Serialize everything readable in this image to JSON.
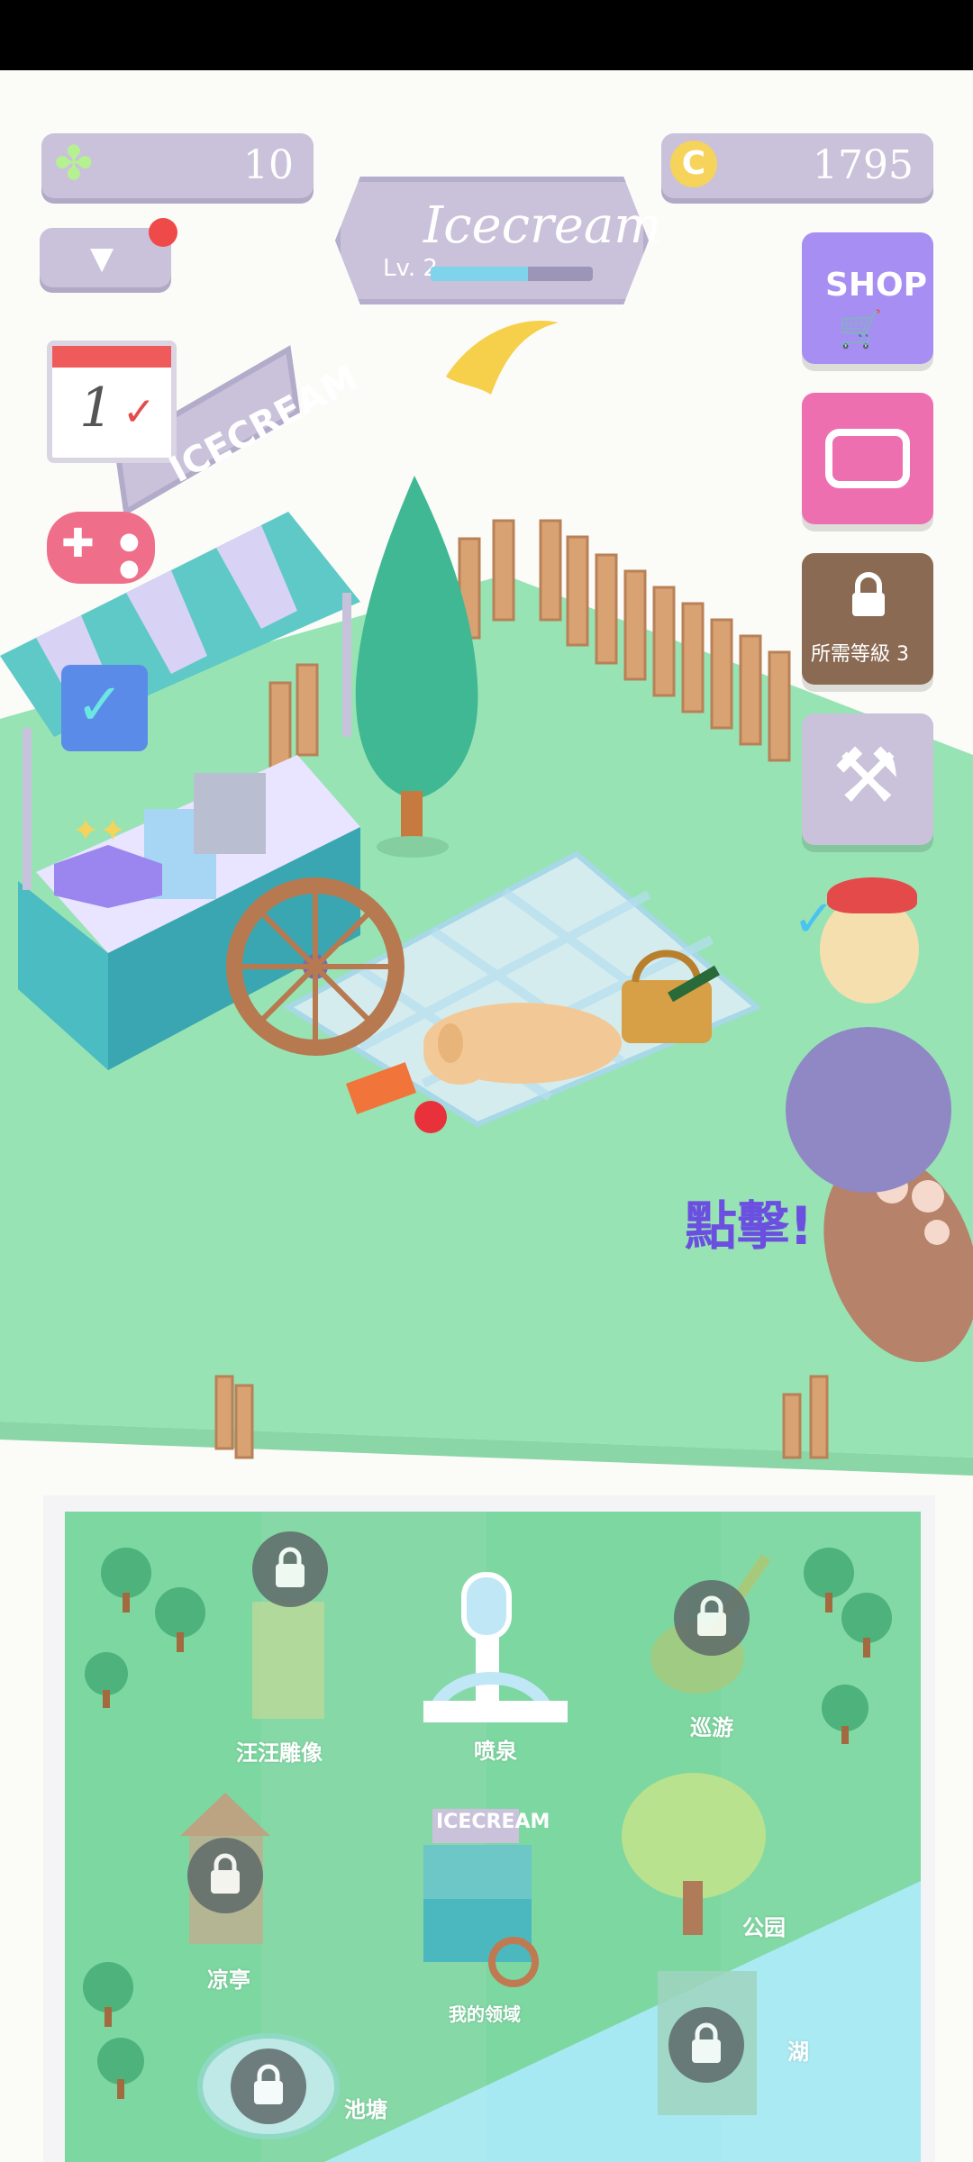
{
  "hud": {
    "clover_count": "10",
    "coin_count": "1795",
    "player_name": "Icecream",
    "level_label": "Lv. 2",
    "xp_progress": 0.6
  },
  "stand": {
    "sign_text": "ICECREAM"
  },
  "side": {
    "shop_label": "SHOP",
    "locked_wardrobe_label": "所需等級 3"
  },
  "tap_hint": "點擊!",
  "map": {
    "sign_text": "ICECREAM",
    "locations": [
      {
        "label": "汪汪雕像"
      },
      {
        "label": "喷泉"
      },
      {
        "label": "巡游"
      },
      {
        "label": "凉亭"
      },
      {
        "label": "我的领域"
      },
      {
        "label": "公园"
      },
      {
        "label": "湖"
      },
      {
        "label": "池塘"
      }
    ]
  },
  "calendar_day": "1",
  "colors": {
    "grass": "#97e3b4",
    "map_green": "#7dd7a1",
    "water": "#a6e9f2",
    "hud": "#c9c2da",
    "shop": "#a78ef2",
    "treasure": "#ee6fb0"
  }
}
